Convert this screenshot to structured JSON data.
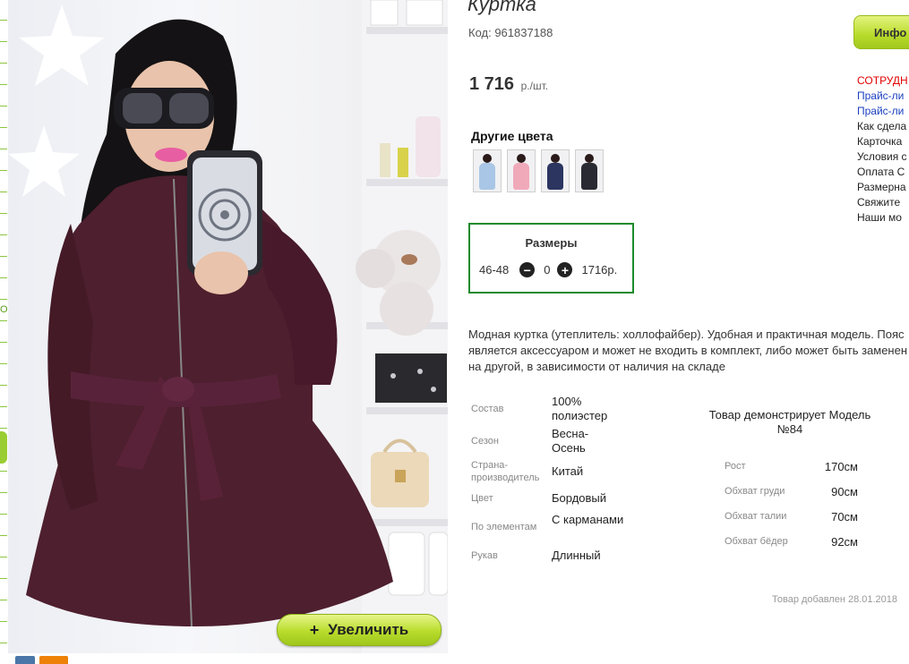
{
  "product": {
    "title": "Куртка",
    "code": "Код: 961837188",
    "price": "1 716",
    "price_unit": "р./шт."
  },
  "photo": {
    "zoom_label": "Увеличить",
    "zoom_plus": "+"
  },
  "other_colors": {
    "heading": "Другие цвета",
    "swatches": [
      "#a9c6e6",
      "#f0a9b9",
      "#2c3560",
      "#2a2a33"
    ]
  },
  "sizes": {
    "heading": "Размеры",
    "size": "46-48",
    "qty": "0",
    "price": "1716р."
  },
  "description": "Модная куртка (утеплитель: холлофайбер). Удобная и практичная модель. Пояс является аксессуаром и может не входить в комплект, либо может быть заменен на другой, в зависимости от наличия на складе",
  "attributes": [
    {
      "label": "Состав",
      "value": "100% полиэстер"
    },
    {
      "label": "Сезон",
      "value": "Весна-Осень"
    },
    {
      "label": "Страна-производитель",
      "value": "Китай"
    },
    {
      "label": "Цвет",
      "value": "Бордовый"
    },
    {
      "label": "По элементам",
      "value": "С карманами"
    },
    {
      "label": "Рукав",
      "value": "Длинный"
    }
  ],
  "model": {
    "heading": "Товар демонстрирует Модель №84",
    "measurements": [
      {
        "label": "Рост",
        "value": "170см"
      },
      {
        "label": "Обхват груди",
        "value": "90см"
      },
      {
        "label": "Обхват талии",
        "value": "70см"
      },
      {
        "label": "Обхват бёдер",
        "value": "92см"
      }
    ]
  },
  "added": "Товар добавлен 28.01.2018",
  "sidebar": {
    "info_button": "Инфо",
    "links": [
      {
        "text": "СОТРУДН",
        "color": "#e00000"
      },
      {
        "text": "Прайс-ли",
        "color": "#1a3fbf"
      },
      {
        "text": "Прайс-ли",
        "color": "#1a3fbf"
      },
      {
        "text": "Как сдела",
        "color": "#222222"
      },
      {
        "text": "Карточка",
        "color": "#222222"
      },
      {
        "text": "Условия с",
        "color": "#222222"
      },
      {
        "text": "Оплата С",
        "color": "#222222"
      },
      {
        "text": "Размерна",
        "color": "#222222"
      },
      {
        "text": "Свяжите",
        "color": "#222222"
      },
      {
        "text": "Наши мо",
        "color": "#222222"
      }
    ]
  },
  "edge": {
    "marker": "О"
  }
}
